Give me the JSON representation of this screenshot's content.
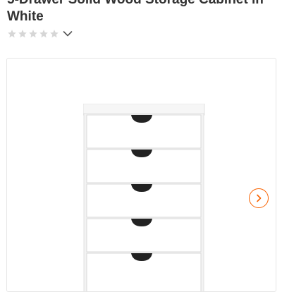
{
  "product": {
    "title": "5-Drawer Solid Wood Storage Cabinet in White"
  },
  "rating": {
    "value": 0,
    "max": 5,
    "star_color": "#d6d6d6"
  },
  "gallery": {
    "next_icon_color": "#f96302",
    "border_color": "#e6e6e6"
  },
  "icons": {
    "rating_toggle": "chevron-down-icon",
    "gallery_next": "chevron-right-icon"
  }
}
